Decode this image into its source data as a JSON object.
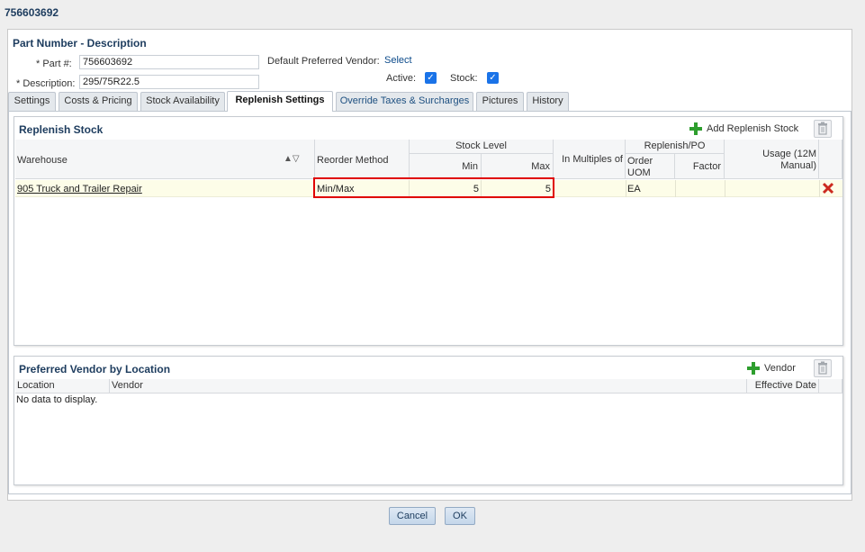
{
  "window": {
    "title": "756603692"
  },
  "part_header": {
    "section_title": "Part Number - Description",
    "part_label": "* Part #:",
    "part_value": "756603692",
    "description_label": "* Description:",
    "description_value": "295/75R22.5",
    "vendor_label": "Default Preferred Vendor:",
    "vendor_link": "Select",
    "active_label": "Active:",
    "active_checked": true,
    "stock_label": "Stock:",
    "stock_checked": true
  },
  "tabs": [
    {
      "label": "Settings",
      "active": false
    },
    {
      "label": "Costs & Pricing",
      "active": false
    },
    {
      "label": "Stock Availability",
      "active": false
    },
    {
      "label": "Replenish Settings",
      "active": true
    },
    {
      "label": "Override Taxes & Surcharges",
      "active": false
    },
    {
      "label": "Pictures",
      "active": false
    },
    {
      "label": "History",
      "active": false
    }
  ],
  "replenish": {
    "title": "Replenish Stock",
    "add_label": "Add Replenish Stock",
    "columns": {
      "warehouse": "Warehouse",
      "reorder_method": "Reorder Method",
      "stock_level": "Stock Level",
      "min": "Min",
      "max": "Max",
      "in_multiples": "In Multiples of",
      "replenish_po": "Replenish/PO",
      "order_uom": "Order UOM",
      "factor": "Factor",
      "usage": "Usage (12M Manual)"
    },
    "rows": [
      {
        "warehouse": "905 Truck and Trailer Repair",
        "reorder_method": "Min/Max",
        "min": "5",
        "max": "5",
        "in_multiples": "",
        "order_uom": "EA",
        "factor": "",
        "usage": ""
      }
    ]
  },
  "preferred_vendor": {
    "title": "Preferred Vendor by Location",
    "add_label": "Vendor",
    "columns": {
      "location": "Location",
      "vendor": "Vendor",
      "effective_date": "Effective Date"
    },
    "empty_text": "No data to display."
  },
  "footer": {
    "cancel_label": "Cancel",
    "ok_label": "OK"
  },
  "colors": {
    "accent": "#1d3c5e",
    "link": "#0b4a8a",
    "highlight": "#e00000",
    "row_bg": "#fdfde8"
  }
}
